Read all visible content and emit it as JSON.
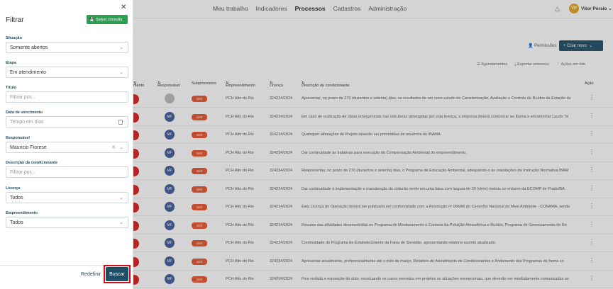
{
  "topnav": {
    "items": [
      "Meu trabalho",
      "Indicadores",
      "Processos",
      "Cadastros",
      "Administração"
    ],
    "active": "Processos",
    "user_initials": "VP",
    "user_name": "Vitor Pérsio"
  },
  "toolbar": {
    "permissoes_label": "Permissões",
    "criar_label": "+ Criar novo",
    "agendamentos_label": "Agendamentos",
    "exportar_label": "Exportar processo",
    "acoes_label": "Ações em lote"
  },
  "table": {
    "headers": [
      "mento",
      "Responsável",
      "Subprocessos",
      "Empreendimento",
      "Licença",
      "Descrição da condicionante",
      "Ação"
    ],
    "rows": [
      {
        "responsavel": "",
        "sub": "16/4",
        "empreendimento": "PCH Alto do Rio",
        "licenca": "324234/2024",
        "descricao": "Apresentar, no prazo de 270 (duzentos e setenta) dias, os resultados de um novo estudo de Caracterização, Avaliação e Controle de Ruídos da Estação de"
      },
      {
        "responsavel": "MF",
        "sub": "16/4",
        "empreendimento": "PCH Alto do Rio",
        "licenca": "324234/2024",
        "descricao": "Em caso de realização de obras emergenciais nas estruturas abrangidas por esta licença, a empresa deverá comunicar ao Ibama e encaminhar Laudo Té"
      },
      {
        "responsavel": "MF",
        "sub": "16/4",
        "empreendimento": "PCH Alto do Rio",
        "licenca": "324234/2024",
        "descricao": "Quaisquer alterações de Projeto deverão ser precedidas de anuência do IBAMA."
      },
      {
        "responsavel": "MF",
        "sub": "16/4",
        "empreendimento": "PCH Alto do Rio",
        "licenca": "324234/2024",
        "descricao": "Dar continuidade às tratativas para execução da Compensação Ambiental do empreendimento."
      },
      {
        "responsavel": "MF",
        "sub": "16/4",
        "empreendimento": "PCH Alto do Rio",
        "licenca": "324234/2024",
        "descricao": "Reapresentar, no prazo de 270 (duzentos e setenta) dias, o Programa de Educação Ambiental, adequando-o às orientações da Instrução Normativa IBAM"
      },
      {
        "responsavel": "MF",
        "sub": "16/4",
        "empreendimento": "PCH Alto do Rio",
        "licenca": "324234/2024",
        "descricao": "Dar continuidade à implementação e manutenção do cinturão verde em uma faixa com largura de 20 (vinte) metros no entorno da ECOMP de Prado/BA."
      },
      {
        "responsavel": "MF",
        "sub": "16/4",
        "empreendimento": "PCH Alto do Rio",
        "licenca": "324234/2024",
        "descricao": "Esta Licença de Operação deverá ser publicada em conformidade com a Resolução nº 006/86 do Conselho Nacional do Meio Ambiente - CONAMA, sendo"
      },
      {
        "responsavel": "MF",
        "sub": "16/4",
        "empreendimento": "PCH Alto do Rio",
        "licenca": "324234/2024",
        "descricao": "Resumo das atividades desenvolvidas no Programa de Monitoramento e Controle da Poluição Atmosférica e Ruídos, Programa de Gerenciamento de Re"
      },
      {
        "responsavel": "MF",
        "sub": "16/4",
        "empreendimento": "PCH Alto do Rio",
        "licenca": "324234/2024",
        "descricao": "Continuidade do Programa de Estabelecimento da Faixa de Servidão, apresentando relatório sucinto atualizado."
      },
      {
        "responsavel": "MF",
        "sub": "16/4",
        "empreendimento": "PCH Alto do Rio",
        "licenca": "324234/2024",
        "descricao": "Apresentar anualmente, preferencialmente até o mês de março, Relatório de Atendimento de Condicionantes e Andamento dos Programas de forma co"
      },
      {
        "responsavel": "MF",
        "sub": "16/4",
        "empreendimento": "PCH Alto do Rio",
        "licenca": "324234/2024",
        "descricao": "Fica vedada a exposição do duto, excetuando os casos previstos em projetos ou situações excepcionais, que deverão ser imediatamente comunicadas ao"
      }
    ]
  },
  "filter": {
    "title": "Filtrar",
    "save_label": "Salvar consulta",
    "fields": {
      "situacao": {
        "label": "Situação",
        "value": "Somente abertos"
      },
      "etapa": {
        "label": "Etapa",
        "value": "Em atendimento"
      },
      "titulo": {
        "label": "Título",
        "placeholder": "Filtrar por..."
      },
      "vencimento": {
        "label": "Data de vencimento",
        "placeholder": "Tempo em dias"
      },
      "responsavel": {
        "label": "Responsável",
        "value": "Mauricio Fiorese"
      },
      "descricao": {
        "label": "Descrição da condicionante",
        "placeholder": "Filtrar por..."
      },
      "licenca": {
        "label": "Licença",
        "value": "Todos"
      },
      "empreendimento": {
        "label": "Empreendimento",
        "value": "Todos"
      }
    },
    "redefinir_label": "Redefinir",
    "buscar_label": "Buscar"
  }
}
